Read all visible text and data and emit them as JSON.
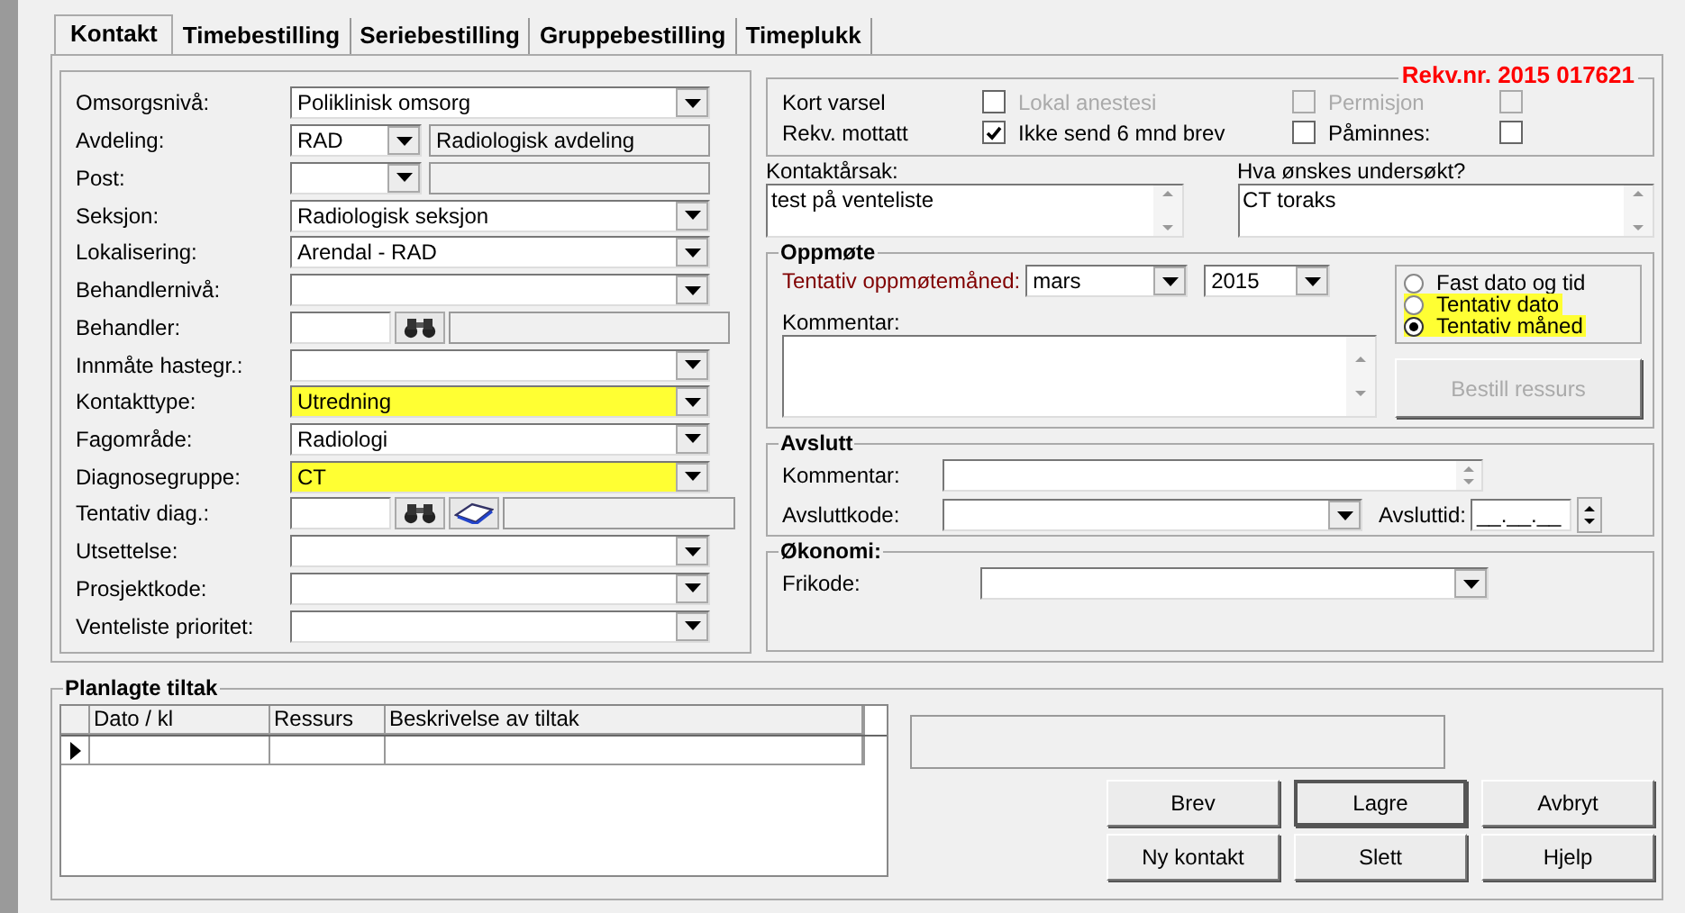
{
  "tabs": [
    {
      "label": "Kontakt",
      "selected": true
    },
    {
      "label": "Timebestilling",
      "selected": false
    },
    {
      "label": "Seriebestilling",
      "selected": false
    },
    {
      "label": "Gruppebestilling",
      "selected": false
    },
    {
      "label": "Timeplukk",
      "selected": false
    }
  ],
  "fields": [
    {
      "kind": "combo",
      "label": "Omsorgsnivå:",
      "value": "Poliklinisk omsorg",
      "highlighted": false
    },
    {
      "kind": "code",
      "label": "Avdeling:",
      "value": "RAD",
      "detail": "Radiologisk avdeling",
      "highlighted": false
    },
    {
      "kind": "code",
      "label": "Post:",
      "highlighted": false
    },
    {
      "kind": "combo",
      "label": "Seksjon:",
      "value": "Radiologisk seksjon",
      "highlighted": false
    },
    {
      "kind": "combo",
      "label": "Lokalisering:",
      "value": "Arendal - RAD",
      "highlighted": false
    },
    {
      "kind": "combo",
      "label": "Behandlernivå:",
      "highlighted": false
    },
    {
      "kind": "lookup",
      "label": "Behandler:",
      "highlighted": false
    },
    {
      "kind": "combo",
      "label": "Innmåte hastegr.:",
      "highlighted": false
    },
    {
      "kind": "combo",
      "label": "Kontakttype:",
      "value": "Utredning",
      "highlighted": true
    },
    {
      "kind": "combo",
      "label": "Fagområde:",
      "value": "Radiologi",
      "highlighted": false
    },
    {
      "kind": "combo",
      "label": "Diagnosegruppe:",
      "value": "CT",
      "highlighted": true
    },
    {
      "kind": "lookup-book",
      "label": "Tentativ diag.:",
      "highlighted": false
    },
    {
      "kind": "combo",
      "label": "Utsettelse:",
      "highlighted": false
    },
    {
      "kind": "combo",
      "label": "Prosjektkode:",
      "highlighted": false
    },
    {
      "kind": "combo",
      "label": "Venteliste prioritet:",
      "highlighted": false
    }
  ],
  "flags": {
    "title": "Rekv.nr. 2015 017621",
    "items": [
      {
        "label": "Kort varsel",
        "checked": false,
        "disabled": false
      },
      {
        "label": "Lokal anestesi",
        "checked": false,
        "disabled": true
      },
      {
        "label": "Permisjon",
        "checked": false,
        "disabled": true
      },
      {
        "label": "Rekv. mottatt",
        "checked": true,
        "disabled": false
      },
      {
        "label": "Ikke send 6 mnd brev",
        "checked": false,
        "disabled": false
      },
      {
        "label": "Påminnes:",
        "checked": false,
        "disabled": false
      }
    ]
  },
  "notes": [
    {
      "label": "Kontaktårsak:",
      "value": "test på venteliste"
    },
    {
      "label": "Hva ønskes undersøkt?",
      "value": "CT toraks"
    }
  ],
  "oppmote": {
    "title": "Oppmøte",
    "month_label": "Tentativ oppmøtemåned:",
    "month": "mars",
    "year": "2015",
    "options": [
      {
        "label": "Fast dato og tid",
        "selected": false,
        "highlighted": false
      },
      {
        "label": "Tentativ dato",
        "selected": false,
        "highlighted": true
      },
      {
        "label": "Tentativ måned",
        "selected": true,
        "highlighted": true
      }
    ],
    "comment_label": "Kommentar:",
    "order_button": {
      "label": "Bestill ressurs",
      "disabled": true
    }
  },
  "avslutt": {
    "title": "Avslutt",
    "comment_label": "Kommentar:",
    "code_label": "Avsluttkode:",
    "time_label": "Avsluttid:",
    "time_value": "__.__.__"
  },
  "okonomi": {
    "title": "Økonomi:",
    "code_label": "Frikode:"
  },
  "tiltak": {
    "title": "Planlagte tiltak",
    "columns": [
      "Dato / kl",
      "Ressurs",
      "Beskrivelse av tiltak"
    ]
  },
  "buttons": [
    {
      "label": "Brev",
      "default": false
    },
    {
      "label": "Lagre",
      "default": true
    },
    {
      "label": "Avbryt",
      "default": false
    },
    {
      "label": "Ny kontakt",
      "default": false
    },
    {
      "label": "Slett",
      "default": false
    },
    {
      "label": "Hjelp",
      "default": false
    }
  ]
}
